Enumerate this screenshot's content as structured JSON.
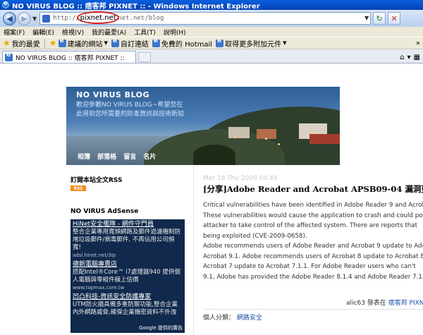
{
  "window": {
    "title": "NO VIRUS BLOG :: 痞客邦 PIXNET :: - Windows Internet Explorer"
  },
  "address_bar": {
    "url": "http://alic63.pixnet.net/blog",
    "highlighted_domain": "pixnet.net"
  },
  "menu": [
    "檔案(F)",
    "編輯(E)",
    "檢視(V)",
    "我的最愛(A)",
    "工具(T)",
    "說明(H)"
  ],
  "favorites_bar": {
    "label": "我的最愛",
    "items": [
      "建議的網站",
      "自訂連結",
      "免費的 Hotmail",
      "取得更多附加元件"
    ]
  },
  "tab": {
    "label": "NO VIRUS BLOG :: 痞客邦 PIXNET ::"
  },
  "blog": {
    "title": "NO VIRUS BLOG",
    "description": "歡迎參觀NO VIRUS BLOG~希望您在此得到您所需要的防毒資訊與技術新知",
    "nav": [
      "相簿",
      "部落格",
      "留言",
      "名片"
    ]
  },
  "sidebar": {
    "rss_title": "訂閱本站全文RSS",
    "rss_badge": "RSS",
    "adsense_title": "NO VIRUS AdSense",
    "ads": [
      {
        "title": "HiNet安全艦隊 - 網件守門員",
        "text": "整合企業專用寬頻網路及郵件過濾機制防堵垃圾郵件/病毒郵件, 不再佔用公司頻寬!",
        "url": "adsl.hinet.net/3ip"
      },
      {
        "title": "德新電腦專賣店",
        "text": "搭配Intel®Core™ i7處理器940 提供個人電腦與零組件線上估價",
        "url": "www.topmax.com.tw"
      },
      {
        "title": "凹凸科技-資訊安全防護專家",
        "text": "UTM防火牆具備多重防禦功能,整合企業 內外網路威脅,確保企業機密資料不外洩",
        "url": ""
      }
    ],
    "google_label": "Google 提供的廣告"
  },
  "post": {
    "date": "Mar 18 Thu 2009 04:49",
    "title": "[分享]Adobe Reader and Acrobat APSB09-04 漏洞更新",
    "body_lines": [
      "Critical vulnerabilities have been identified in Adobe Reader 9 and Acrobat",
      "These vulnerabilities would cause the application to crash and could pote",
      "attacker to take control of the affected system. There are reports that",
      "being exploited (CVE-2009-0658).",
      "Adobe recommends users of Adobe Reader and Acrobat 9 update to Adob",
      "Acrobat 9.1. Adobe recommends users of Acrobat 8 update to Acrobat 8",
      "Acrobat 7 update to Acrobat 7.1.1. For Adobe Reader users who can't",
      "9.1, Adobe has provided the Adobe Reader 8.1.4 and Adobe Reader 7.1."
    ],
    "author": "alic63",
    "posted_in_text": "發表在",
    "site_link": "痞客邦 PIXNET",
    "category_label": "個人分類：",
    "category_link": "網路安全"
  }
}
